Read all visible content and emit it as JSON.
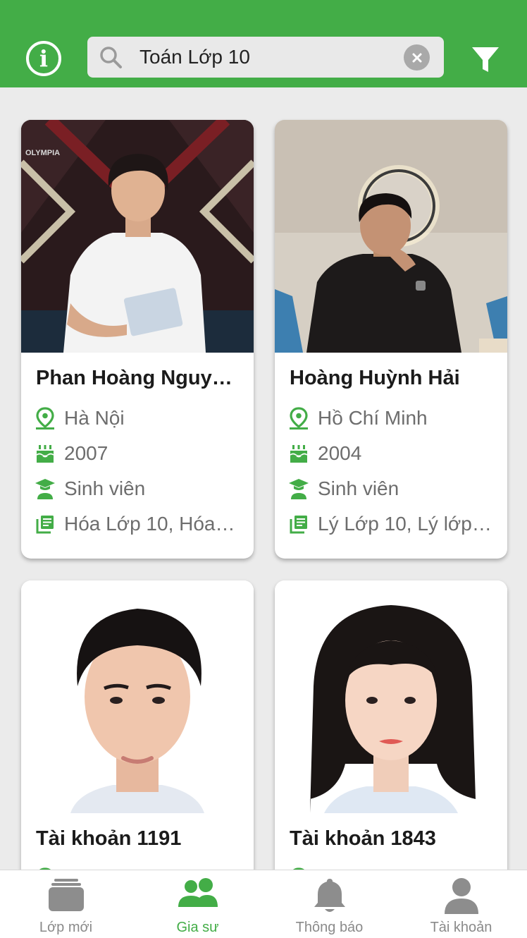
{
  "header": {
    "search_query": "Toán Lớp 10",
    "info_icon": "info-circle-icon",
    "search_icon": "magnifier-icon",
    "clear_icon": "clear-x-icon",
    "filter_icon": "funnel-icon"
  },
  "colors": {
    "accent": "#43ad47",
    "text_secondary": "#6d6d6d"
  },
  "tutors": [
    {
      "name": "Phan Hoàng Nguy…",
      "location": "Hà Nội",
      "birth_year": "2007",
      "role": "Sinh viên",
      "subjects": "Hóa Lớp 10, Hóa…"
    },
    {
      "name": "Hoàng Huỳnh Hải",
      "location": "Hồ Chí Minh",
      "birth_year": "2004",
      "role": "Sinh viên",
      "subjects": "Lý Lớp 10, Lý lớp…"
    },
    {
      "name": "Tài khoản 1191"
    },
    {
      "name": "Tài khoản 1843"
    }
  ],
  "photo_overlay_text": "OLYMPIA",
  "nav": {
    "items": [
      {
        "label": "Lớp mới",
        "icon": "stacked-classes-icon"
      },
      {
        "label": "Gia sư",
        "icon": "people-icon",
        "active": true
      },
      {
        "label": "Thông báo",
        "icon": "bell-icon"
      },
      {
        "label": "Tài khoản",
        "icon": "user-icon"
      }
    ]
  }
}
